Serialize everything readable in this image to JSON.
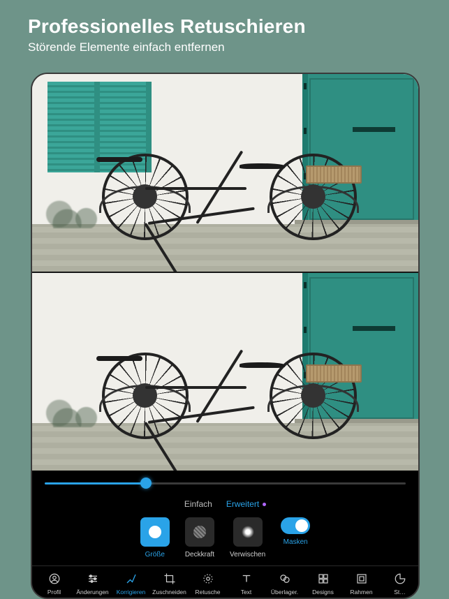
{
  "header": {
    "title": "Professionelles Retuschieren",
    "subtitle": "Störende Elemente einfach entfernen"
  },
  "slider": {
    "value_percent": 28
  },
  "modes": {
    "simple": "Einfach",
    "advanced": "Erweitert",
    "active": "advanced"
  },
  "tools": {
    "size": {
      "label": "Größe",
      "active": true
    },
    "opacity": {
      "label": "Deckkraft",
      "active": false
    },
    "blend": {
      "label": "Verwischen",
      "active": false
    },
    "mask": {
      "label": "Masken",
      "active": false,
      "toggle_on": true
    }
  },
  "nav": {
    "items": [
      {
        "id": "profil",
        "label": "Profil"
      },
      {
        "id": "aenderungen",
        "label": "Änderungen"
      },
      {
        "id": "korrigieren",
        "label": "Korrigieren",
        "active": true
      },
      {
        "id": "zuschneiden",
        "label": "Zuschneiden"
      },
      {
        "id": "retusche",
        "label": "Retusche"
      },
      {
        "id": "text",
        "label": "Text"
      },
      {
        "id": "ueberlager",
        "label": "Überlager."
      },
      {
        "id": "designs",
        "label": "Designs"
      },
      {
        "id": "rahmen",
        "label": "Rahmen"
      },
      {
        "id": "sticker",
        "label": "St…"
      }
    ]
  },
  "icons": {
    "size": "size-circle-icon",
    "opacity": "opacity-hatch-icon",
    "blend": "blend-soft-icon",
    "mask": "toggle-icon"
  }
}
